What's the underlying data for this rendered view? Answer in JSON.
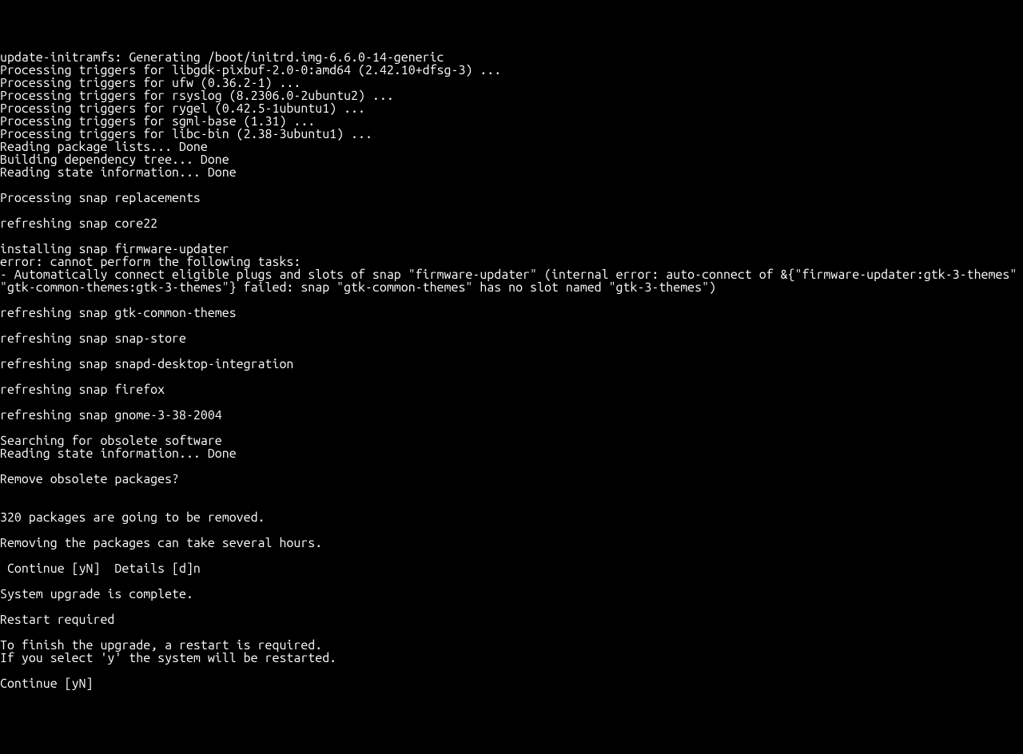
{
  "terminal": {
    "lines": [
      "update-initramfs: Generating /boot/initrd.img-6.6.0-14-generic",
      "Processing triggers for libgdk-pixbuf-2.0-0:amd64 (2.42.10+dfsg-3) ...",
      "Processing triggers for ufw (0.36.2-1) ...",
      "Processing triggers for rsyslog (8.2306.0-2ubuntu2) ...",
      "Processing triggers for rygel (0.42.5-1ubuntu1) ...",
      "Processing triggers for sgml-base (1.31) ...",
      "Processing triggers for libc-bin (2.38-3ubuntu1) ...",
      "Reading package lists... Done",
      "Building dependency tree... Done",
      "Reading state information... Done",
      "",
      "Processing snap replacements",
      "",
      "refreshing snap core22",
      "",
      "installing snap firmware-updater",
      "error: cannot perform the following tasks:",
      "- Automatically connect eligible plugs and slots of snap \"firmware-updater\" (internal error: auto-connect of &{\"firmware-updater:gtk-3-themes\" \"gtk-common-themes:gtk-3-themes\"} failed: snap \"gtk-common-themes\" has no slot named \"gtk-3-themes\")",
      "",
      "refreshing snap gtk-common-themes",
      "",
      "refreshing snap snap-store",
      "",
      "refreshing snap snapd-desktop-integration",
      "",
      "refreshing snap firefox",
      "",
      "refreshing snap gnome-3-38-2004",
      "",
      "Searching for obsolete software",
      "Reading state information... Done",
      "",
      "Remove obsolete packages?",
      "",
      "",
      "320 packages are going to be removed.",
      "",
      "Removing the packages can take several hours.",
      "",
      " Continue [yN]  Details [d]n",
      "",
      "System upgrade is complete.",
      "",
      "Restart required",
      "",
      "To finish the upgrade, a restart is required.",
      "If you select 'y' the system will be restarted.",
      "",
      "Continue [yN]"
    ]
  }
}
